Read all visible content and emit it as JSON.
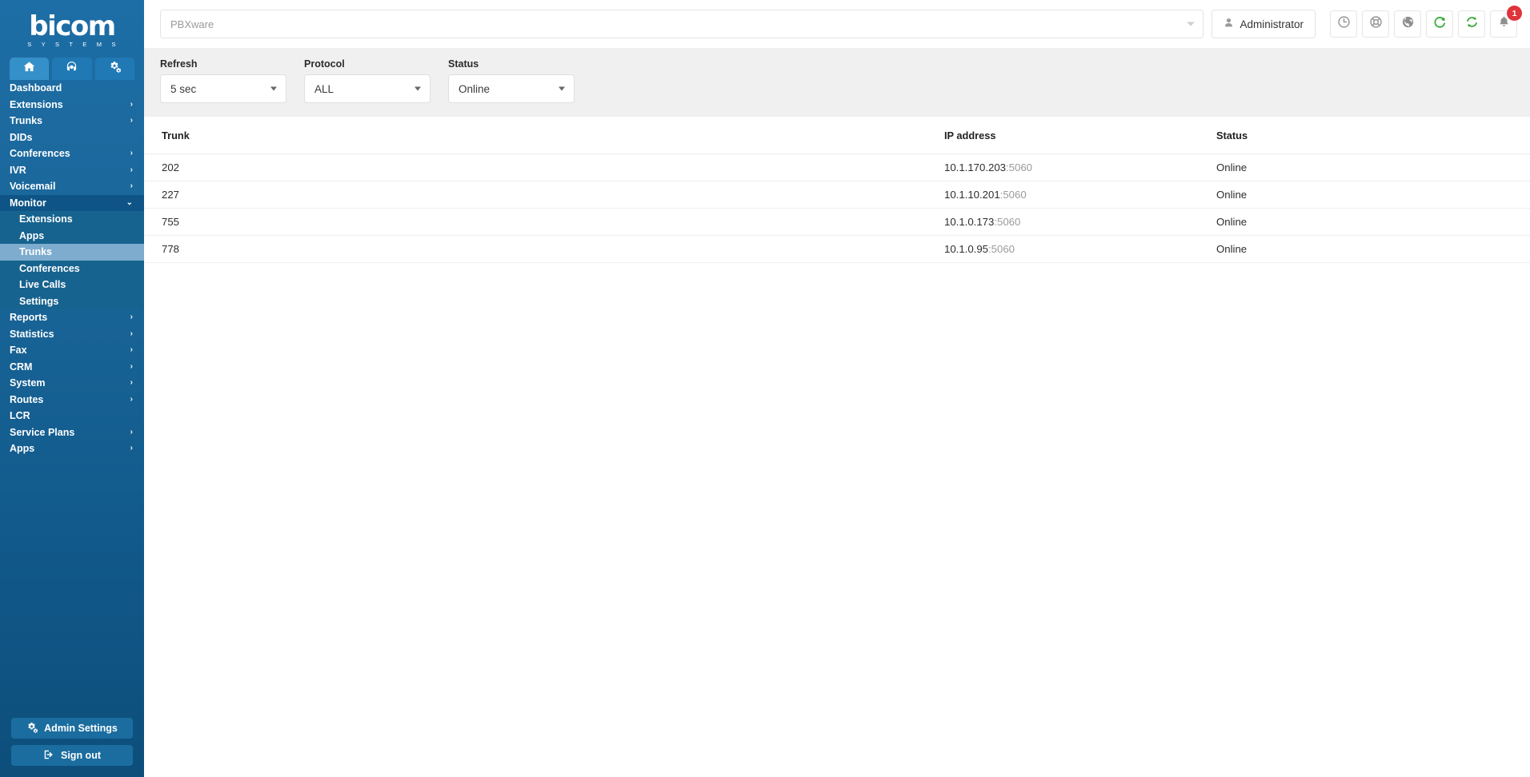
{
  "brand": {
    "name": "bicom",
    "tagline": "S Y S T E M S"
  },
  "sidebar": {
    "icon_tabs": [
      {
        "name": "home-icon",
        "label": "Home",
        "active": true
      },
      {
        "name": "headset-icon",
        "label": "Support",
        "active": false
      },
      {
        "name": "gears-icon",
        "label": "Settings",
        "active": false
      }
    ],
    "items": [
      {
        "label": "Dashboard",
        "has_children": false
      },
      {
        "label": "Extensions",
        "has_children": true
      },
      {
        "label": "Trunks",
        "has_children": true
      },
      {
        "label": "DIDs",
        "has_children": false
      },
      {
        "label": "Conferences",
        "has_children": true
      },
      {
        "label": "IVR",
        "has_children": true
      },
      {
        "label": "Voicemail",
        "has_children": true
      },
      {
        "label": "Monitor",
        "has_children": true,
        "expanded": true
      },
      {
        "label": "Reports",
        "has_children": true
      },
      {
        "label": "Statistics",
        "has_children": true
      },
      {
        "label": "Fax",
        "has_children": true
      },
      {
        "label": "CRM",
        "has_children": true
      },
      {
        "label": "System",
        "has_children": true
      },
      {
        "label": "Routes",
        "has_children": true
      },
      {
        "label": "LCR",
        "has_children": false
      },
      {
        "label": "Service Plans",
        "has_children": true
      },
      {
        "label": "Apps",
        "has_children": true
      }
    ],
    "monitor_submenu": [
      {
        "label": "Extensions",
        "active": false
      },
      {
        "label": "Apps",
        "active": false
      },
      {
        "label": "Trunks",
        "active": true
      },
      {
        "label": "Conferences",
        "active": false
      },
      {
        "label": "Live Calls",
        "active": false
      },
      {
        "label": "Settings",
        "active": false
      }
    ],
    "admin_settings_label": "Admin Settings",
    "sign_out_label": "Sign out"
  },
  "topbar": {
    "tenant_placeholder": "PBXware",
    "tenant_value": "",
    "user_label": "Administrator",
    "icons": [
      {
        "name": "clock-icon"
      },
      {
        "name": "lifebuoy-icon"
      },
      {
        "name": "globe-icon"
      },
      {
        "name": "reload-icon"
      },
      {
        "name": "sync-icon"
      },
      {
        "name": "bell-icon",
        "badge": "1"
      }
    ],
    "notification_count": "1"
  },
  "filters": [
    {
      "label": "Refresh",
      "value": "5 sec"
    },
    {
      "label": "Protocol",
      "value": "ALL"
    },
    {
      "label": "Status",
      "value": "Online"
    }
  ],
  "table": {
    "columns": [
      "Trunk",
      "IP address",
      "Status"
    ],
    "rows": [
      {
        "trunk": "202",
        "ip": "10.1.170.203",
        "port": ":5060",
        "status": "Online"
      },
      {
        "trunk": "227",
        "ip": "10.1.10.201",
        "port": ":5060",
        "status": "Online"
      },
      {
        "trunk": "755",
        "ip": "10.1.0.173",
        "port": ":5060",
        "status": "Online"
      },
      {
        "trunk": "778",
        "ip": "10.1.0.95",
        "port": ":5060",
        "status": "Online"
      }
    ]
  },
  "colors": {
    "sidebar_top": "#1d6ea6",
    "sidebar_bottom": "#0d4e7b",
    "active_submenu": "#7dacce",
    "open_parent": "#0e5486",
    "status_online": "#1f9e36",
    "badge_red": "#e0333a",
    "accent_green": "#34a832",
    "filterbar_bg": "#f0f0f0"
  }
}
